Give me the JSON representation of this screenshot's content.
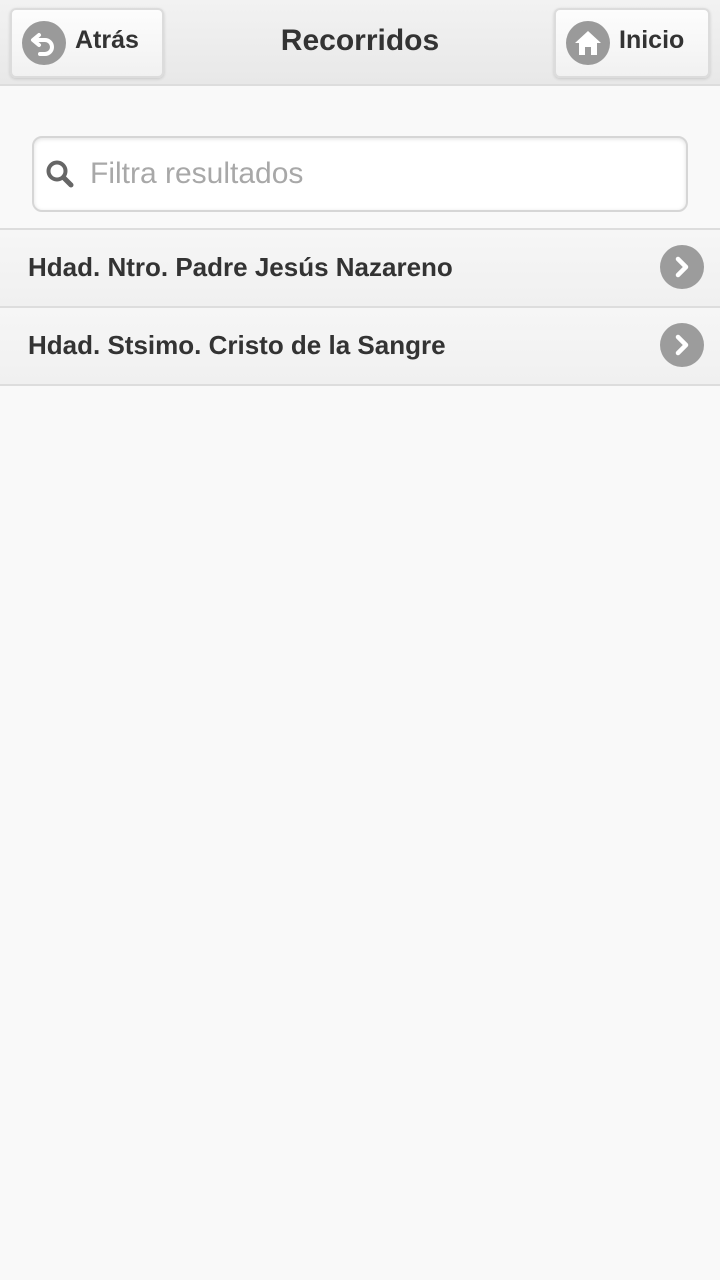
{
  "header": {
    "title": "Recorridos",
    "back_label": "Atrás",
    "home_label": "Inicio"
  },
  "search": {
    "placeholder": "Filtra resultados",
    "value": ""
  },
  "list": {
    "items": [
      {
        "label": "Hdad. Ntro. Padre Jesús Nazareno",
        "icon": "chevron-right-icon"
      },
      {
        "label": "Hdad. Stsimo. Cristo de la Sangre",
        "icon": "chevron-right-icon"
      }
    ]
  },
  "colors": {
    "background": "#f9f9f9",
    "header": "#ececec",
    "icon_circle": "#9a9a9a",
    "text": "#333333",
    "placeholder": "#a8a8a8"
  }
}
